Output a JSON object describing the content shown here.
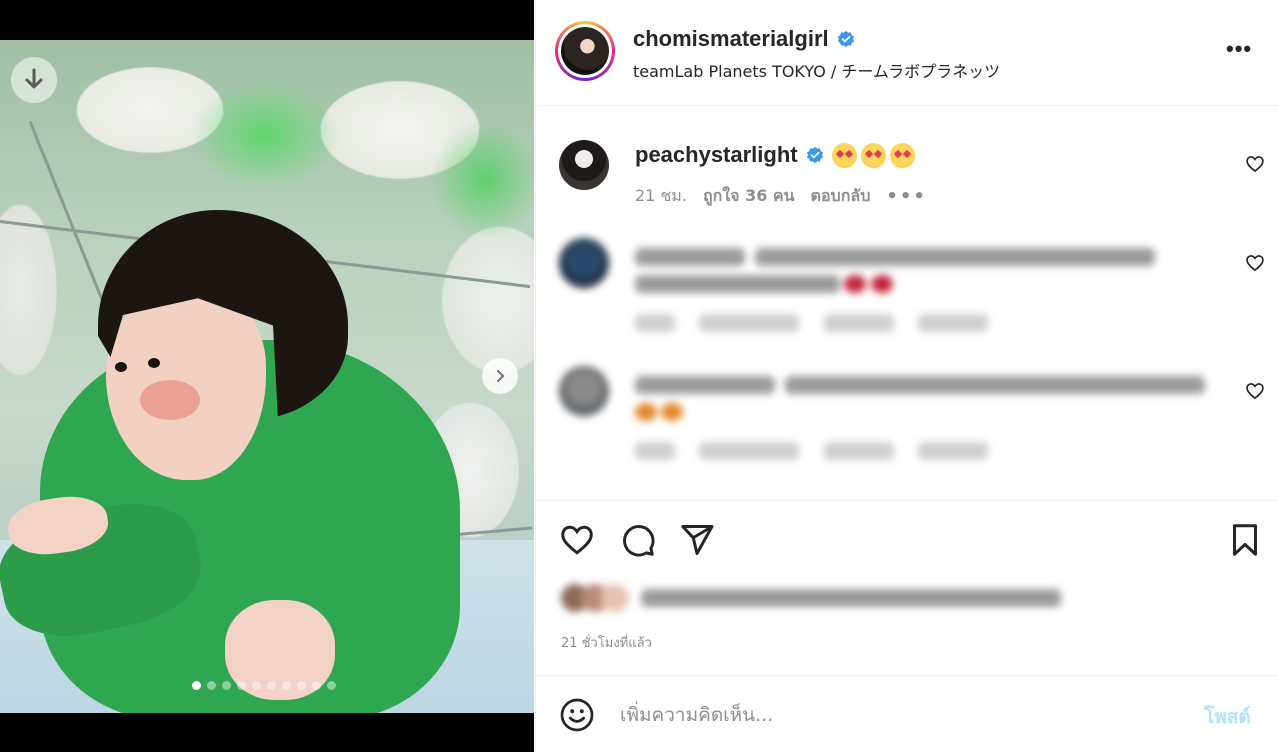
{
  "post": {
    "username": "chomismaterialgirl",
    "location": "teamLab Planets TOKYO / チームラボプラネッツ",
    "verified": true
  },
  "media": {
    "carousel_count": 10,
    "active_index": 0,
    "download_icon": "arrow-down-icon",
    "next_icon": "chevron-right-icon"
  },
  "comments": [
    {
      "username": "peachystarlight",
      "verified": true,
      "text": "🥰🥰🥰",
      "time": "21 ชม.",
      "likes": "ถูกใจ 36 คน",
      "reply": "ตอบกลับ",
      "more": "•••"
    },
    {
      "blurred": true
    },
    {
      "blurred": true
    }
  ],
  "actions": {
    "like_icon": "heart-icon",
    "comment_icon": "comment-bubble-icon",
    "share_icon": "paper-plane-icon",
    "save_icon": "bookmark-icon"
  },
  "footer": {
    "time_ago": "21 ชั่วโมงที่แล้ว"
  },
  "comment_box": {
    "placeholder": "เพิ่มความคิดเห็น...",
    "post_label": "โพสต์",
    "emoji_icon": "smile-icon"
  },
  "colors": {
    "verified_blue": "#3897f0",
    "post_button_disabled": "#b2dffc",
    "meta_gray": "#8e8e8e"
  }
}
